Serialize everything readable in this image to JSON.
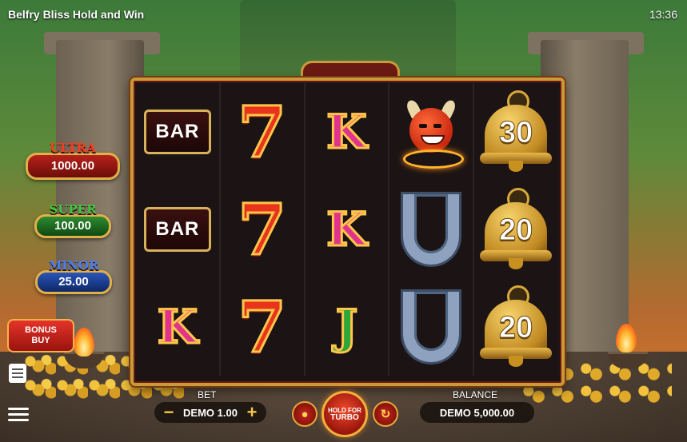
{
  "header": {
    "title": "Belfry Bliss Hold and Win",
    "time": "13:36"
  },
  "jackpots": {
    "ultra": {
      "label": "ULTRA",
      "value": "1000.00"
    },
    "super": {
      "label": "SUPER",
      "value": "100.00"
    },
    "minor": {
      "label": "MINOR",
      "value": "25.00"
    }
  },
  "bonus_buy": {
    "line1": "BONUS",
    "line2": "BUY"
  },
  "reels": [
    [
      "bar",
      "bar",
      "k"
    ],
    [
      "seven",
      "seven",
      "seven"
    ],
    [
      "k",
      "k",
      "j"
    ],
    [
      "devil",
      "horseshoe",
      "horseshoe"
    ],
    [
      "bell",
      "bell",
      "bell"
    ]
  ],
  "symbols": {
    "bar_text": "BAR",
    "seven_text": "7",
    "k_text": "K",
    "j_text": "J",
    "bell_values": [
      "30",
      "20",
      "20"
    ]
  },
  "controls": {
    "bet_label": "BET",
    "bet_value": "DEMO 1.00",
    "minus": "−",
    "plus": "+",
    "spin_line1": "HOLD FOR",
    "spin_line2": "TURBO",
    "balance_label": "BALANCE",
    "balance_value": "DEMO 5,000.00"
  },
  "colors": {
    "frame_gold": "#c99a3a",
    "ultra": "#ff3b1e",
    "super": "#3ec73e",
    "minor": "#4a7ff0"
  }
}
